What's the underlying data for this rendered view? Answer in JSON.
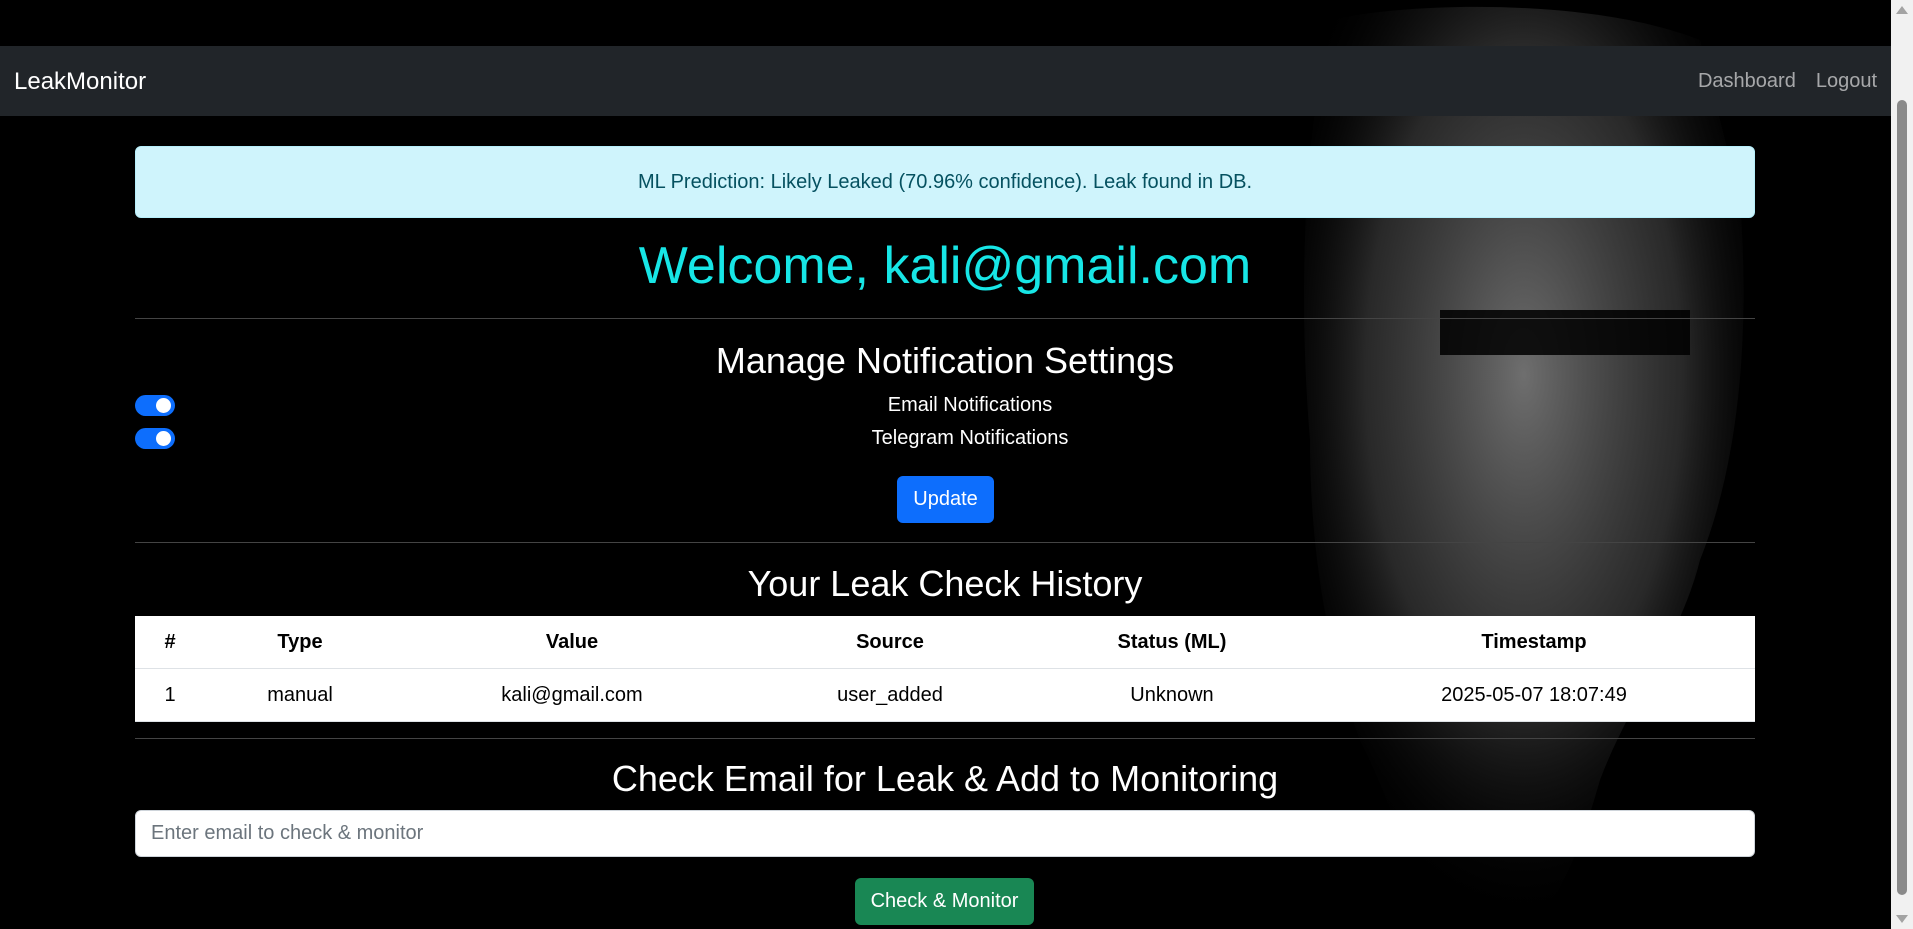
{
  "navbar": {
    "brand": "LeakMonitor",
    "links": [
      "Dashboard",
      "Logout"
    ]
  },
  "alert": {
    "message": "ML Prediction: Likely Leaked (70.96% confidence). Leak found in DB."
  },
  "welcome": "Welcome, kali@gmail.com",
  "notifications": {
    "title": "Manage Notification Settings",
    "items": [
      {
        "label": "Email Notifications",
        "enabled": true
      },
      {
        "label": "Telegram Notifications",
        "enabled": true
      }
    ],
    "update_label": "Update"
  },
  "history": {
    "title": "Your Leak Check History",
    "columns": [
      "#",
      "Type",
      "Value",
      "Source",
      "Status (ML)",
      "Timestamp"
    ],
    "rows": [
      [
        "1",
        "manual",
        "kali@gmail.com",
        "user_added",
        "Unknown",
        "2025-05-07 18:07:49"
      ]
    ]
  },
  "check": {
    "title": "Check Email for Leak & Add to Monitoring",
    "placeholder": "Enter email to check & monitor",
    "button_label": "Check & Monitor"
  },
  "colors": {
    "accent": "#17e6e6",
    "primary": "#0d6efd",
    "success": "#198754",
    "alert_bg": "#cff4fc"
  }
}
